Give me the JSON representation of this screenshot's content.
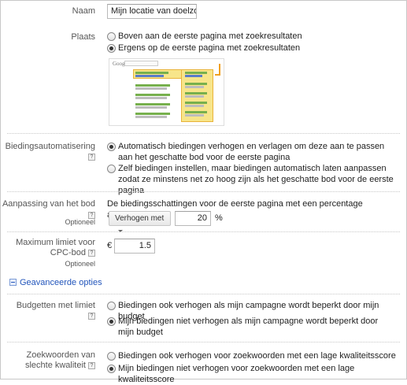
{
  "name": {
    "label": "Naam",
    "value": "Mijn locatie van doelzoekp"
  },
  "place": {
    "label": "Plaats",
    "options": [
      {
        "label": "Boven aan de eerste pagina met zoekresultaten",
        "selected": false
      },
      {
        "label": "Ergens op de eerste pagina met zoekresultaten",
        "selected": true
      }
    ],
    "preview": {
      "logo_text": "Google"
    }
  },
  "automation": {
    "label": "Biedingsautomatisering",
    "help": "?",
    "options": [
      {
        "label": "Automatisch biedingen verhogen en verlagen om deze aan te passen aan het geschatte bod voor de eerste pagina",
        "selected": true
      },
      {
        "label": "Zelf biedingen instellen, maar biedingen automatisch laten aanpassen zodat ze minstens net zo hoog zijn als het geschatte bod voor de eerste pagina",
        "selected": false
      }
    ]
  },
  "adjustment": {
    "label": "Aanpassing van het bod",
    "help": "?",
    "optional": "Optioneel",
    "description": "De biedingsschattingen voor de eerste pagina met een percentage aanpassen",
    "dropdown_value": "Verhogen met",
    "percent_value": "20",
    "percent_unit": "%"
  },
  "max_limit": {
    "label_line1": "Maximum limiet voor",
    "label_line2": "CPC-bod",
    "help": "?",
    "optional": "Optioneel",
    "currency": "€",
    "value": "1.5"
  },
  "advanced_link": "Geavanceerde opties",
  "budget": {
    "label": "Budgetten met limiet",
    "help": "?",
    "options": [
      {
        "label": "Biedingen ook verhogen als mijn campagne wordt beperkt door mijn budget",
        "selected": false
      },
      {
        "label": "Mijn biedingen niet verhogen als mijn campagne wordt beperkt door mijn budget",
        "selected": true
      }
    ]
  },
  "quality": {
    "label_line1": "Zoekwoorden van",
    "label_line2": "slechte kwaliteit",
    "help": "?",
    "options": [
      {
        "label": "Biedingen ook verhogen voor zoekwoorden met een lage kwaliteitsscore",
        "selected": false
      },
      {
        "label": "Mijn biedingen niet verhogen voor zoekwoorden met een lage kwaliteitsscore",
        "selected": true
      }
    ]
  }
}
